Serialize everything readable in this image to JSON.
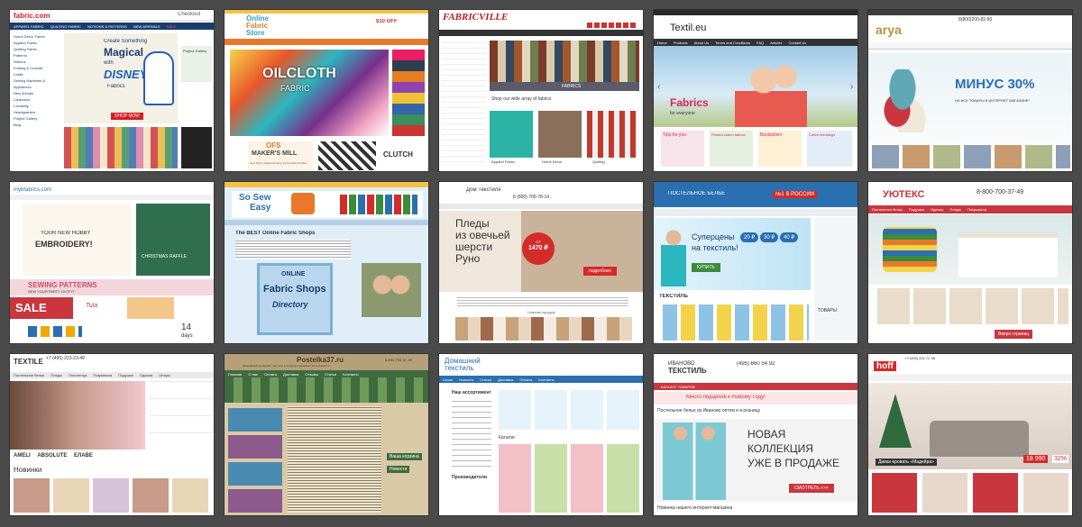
{
  "tiles": [
    {
      "id": "fabric-com",
      "logo": "fabric.com",
      "menu": [
        "APPAREL FABRIC",
        "QUILTING FABRIC",
        "NOTIONS & PATTERNS",
        "NEW ARRIVALS",
        "SALE"
      ],
      "checkout": "Checkout",
      "sidebar": [
        "Home Décor Fabric",
        "Apparel Fabric",
        "Quilting Fabric",
        "Patterns",
        "Notions",
        "Knitting & Crochet",
        "Crafts",
        "Sewing Machines & Appliances",
        "New Arrivals",
        "Clearance",
        "Creativity Headquarters",
        "Project Gallery",
        "Blog"
      ],
      "hero_line1": "Create Something",
      "hero_line2": "Magical",
      "hero_line3": "with",
      "hero_brand": "DISNEY",
      "hero_line4": "Fabrics",
      "cta": "SHOP NOW",
      "side_promo": "Project Gallery"
    },
    {
      "id": "online-fabric-store",
      "logo_line1": "Online",
      "logo_line2": "Fabric",
      "logo_line3": "Store",
      "hero_title": "OILCLOTH",
      "hero_sub": "FABRIC",
      "promo_title": "OFS",
      "promo_line": "MAKER'S MILL",
      "promo_sub": "New Prints, Digital Printing, Personalized Fabric",
      "clutch_label": "CLUTCH",
      "badge": "$10 OFF"
    },
    {
      "id": "fabricville",
      "logo": "FABRICVILLE",
      "tagline": "Shop our wide array of fabrics",
      "section": "FABRICS",
      "categories": [
        "Apparel Fabric",
        "Home Decor",
        "Quilting"
      ]
    },
    {
      "id": "textil-eu",
      "logo": "Textil.eu",
      "nav": [
        "Home",
        "Products",
        "About Us",
        "Terms and Conditions",
        "FAQ",
        "Articles",
        "Contact Us"
      ],
      "hero_title": "Fabrics",
      "hero_sub": "for everyone",
      "cards": [
        "Tips for you",
        "Printed cotton fabrics",
        "Bestsellers",
        "Cotton beddings"
      ]
    },
    {
      "id": "arya",
      "logo": "arya",
      "phone": "8(800)200-82-90",
      "hero_title": "МИНУС 30%",
      "hero_sub": "НА ВСЕ ТОВАРЫ В ИНТЕРНЕТ МАГАЗИНЕ*"
    },
    {
      "id": "mybabrics",
      "logo": "mybfabrics.com",
      "hero_line1": "YOUR NEW HOBBY",
      "hero_line2": "EMBROIDERY!",
      "promo1": "SEWING PATTERNS",
      "promo1_sub": "SEW YOUR PARTY OUTFIT",
      "sale": "SALE",
      "days_num": "14",
      "days_label": "days",
      "side_label": "CHRISTMAS RAFFLE",
      "badge": "Tula"
    },
    {
      "id": "so-sew-easy",
      "logo_line1": "So Sew",
      "logo_line2": "Easy",
      "headline": "The BEST Online Fabric Shops",
      "book_line1": "ONLINE",
      "book_line2": "Fabric Shops",
      "book_line3": "Directory"
    },
    {
      "id": "dom-tekstilya",
      "logo": "Дом Текстиля",
      "phone": "8 (800) 700-78-14",
      "hero_line1": "Пледы",
      "hero_line2": "из овечьей",
      "hero_line3": "шерсти",
      "hero_line4": "Руно",
      "price_from": "ОТ",
      "price": "1470 ₽",
      "cta": "подробнее",
      "section": "Новинки продаж"
    },
    {
      "id": "postelnoe-bele",
      "logo": "ПОСТЕЛЬНОЕ БЕЛЬЕ",
      "badge": "№1 В РОССИИ",
      "hero_line1": "Суперцены",
      "hero_line2": "на текстиль!",
      "discounts": [
        "20 ₽",
        "30 ₽",
        "40 ₽"
      ],
      "cta": "КУПИТЬ",
      "section": "ТЕКСТИЛЬ",
      "side": "ТОВАРЫ"
    },
    {
      "id": "uyuteks",
      "logo": "УЮТЕКС",
      "phone": "8-800-700-37-49",
      "menu": [
        "Постельное белье",
        "Подушки",
        "Одеяла",
        "Пледы",
        "Покрывала"
      ],
      "cta": "Вверх страниц"
    },
    {
      "id": "textile-store",
      "logo": "TEXTILE",
      "phone": "+7 (495) 223-23-49",
      "menu": [
        "Постельное белье",
        "Пледы",
        "Полотенца",
        "Покрывала",
        "Подушки",
        "Одеяла",
        "Шторы"
      ],
      "section": "Новинки",
      "brands": [
        "AMELI",
        "ABSOLUTE",
        "ЕЛАВЕ"
      ]
    },
    {
      "id": "postelka37",
      "logo": "Postelka37.ru",
      "tagline": "Ивановский домашний текстиль в интернет-магазине Постелька37.ru",
      "phone": "8-800-700-37-49",
      "menu": [
        "Главная",
        "О нас",
        "Оплата",
        "Доставка",
        "Отзывы",
        "Статьи",
        "Контакты"
      ],
      "cart": "Ваша корзина",
      "news": "Новости"
    },
    {
      "id": "domashniy-tekstil",
      "logo_line1": "Домашний",
      "logo_line2": "текстиль",
      "menu": [
        "Сезон",
        "Новости",
        "Статьи",
        "Доставка",
        "Оплата",
        "Контакты"
      ],
      "side_title": "Наш ассортимент",
      "section": "Каталог",
      "producers": "Производители"
    },
    {
      "id": "ivanovo-tekstil",
      "logo_line1": "ИВАНОВО",
      "logo_line2": "ТЕКСТИЛЬ",
      "phone": "(495) 660 54 92",
      "catalog": "КАТАЛОГ ТОВАРОВ",
      "gift_banner": "Много подарков к Новому Году!",
      "tagline": "Постельное белье из Иваново оптом и в розницу",
      "hero_line1": "НОВАЯ",
      "hero_line2": "КОЛЛЕКЦИЯ",
      "hero_line3": "УЖЕ В ПРОДАЖЕ",
      "cta": "СМОТРЕТЬ >>>",
      "footer": "Новинка нашего интернет-магазина"
    },
    {
      "id": "hoff",
      "logo": "hoff",
      "phone": "+7 (495) 221 72 35",
      "caption": "Диван-кровать «Мадейра»",
      "price": "18 990",
      "discount": "32%"
    }
  ],
  "colors": {
    "bg": "#4a4a4a",
    "red": "#d42a2a",
    "green": "#3d8b3d",
    "blue": "#2a6fb0",
    "orange": "#e8792a",
    "teal": "#2bb6c0"
  }
}
